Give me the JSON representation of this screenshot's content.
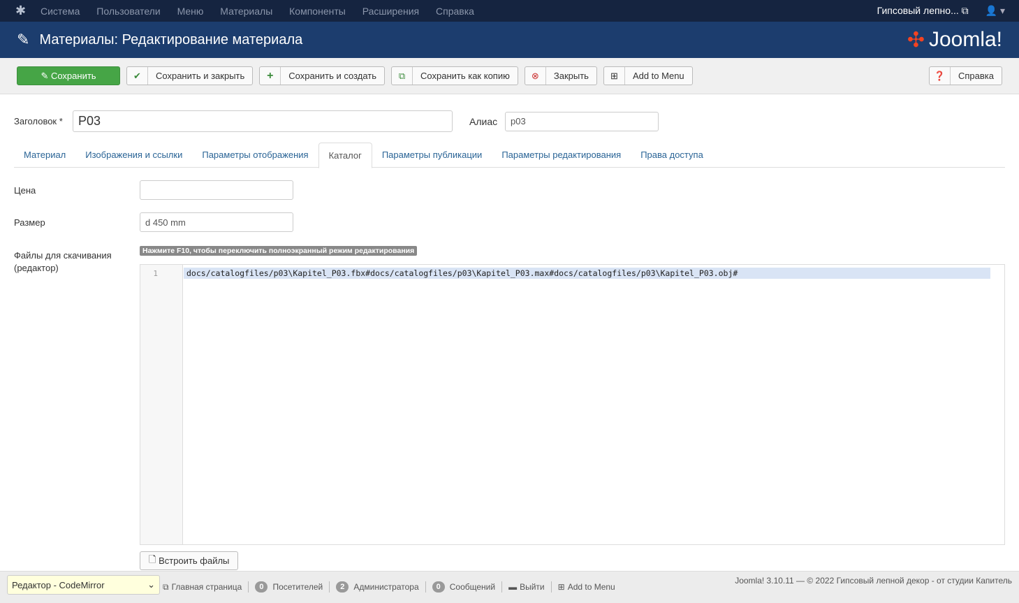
{
  "topnav": {
    "menu": [
      "Система",
      "Пользователи",
      "Меню",
      "Материалы",
      "Компоненты",
      "Расширения",
      "Справка"
    ],
    "site": "Гипсовый лепно...",
    "user_icon": "user-icon"
  },
  "header": {
    "title": "Материалы: Редактирование материала",
    "logo": "Joomla!"
  },
  "toolbar": {
    "save": "Сохранить",
    "save_close": "Сохранить и закрыть",
    "save_new": "Сохранить и создать",
    "save_copy": "Сохранить как копию",
    "close": "Закрыть",
    "add_menu": "Add to Menu",
    "help": "Справка"
  },
  "form": {
    "title_label": "Заголовок *",
    "title_value": "P03",
    "alias_label": "Алиас",
    "alias_value": "p03"
  },
  "tabs": [
    "Материал",
    "Изображения и ссылки",
    "Параметры отображения",
    "Каталог",
    "Параметры публикации",
    "Параметры редактирования",
    "Права доступа"
  ],
  "catalog": {
    "price_label": "Цена",
    "price_value": "",
    "size_label": "Размер",
    "size_value": "d 450 mm",
    "files_label": "Файлы для скачивания (редактор)",
    "hint": "Нажмите F10, чтобы переключить полноэкранный режим редактирования",
    "line_no": "1",
    "code": "docs/catalogfiles/p03\\Kapitel_P03.fbx#docs/catalogfiles/p03\\Kapitel_P03.max#docs/catalogfiles/p03\\Kapitel_P03.obj#",
    "embed_button": "Встроить файлы"
  },
  "footer": {
    "editor_select": "Редактор - CodeMirror",
    "home": "Главная страница",
    "visitors_count": "0",
    "visitors": "Посетителей",
    "admins_count": "2",
    "admins": "Администратора",
    "messages_count": "0",
    "messages": "Сообщений",
    "logout": "Выйти",
    "add_menu": "Add to Menu",
    "copyright": "Joomla! 3.10.11 — © 2022 Гипсовый лепной декор - от студии Капитель"
  }
}
